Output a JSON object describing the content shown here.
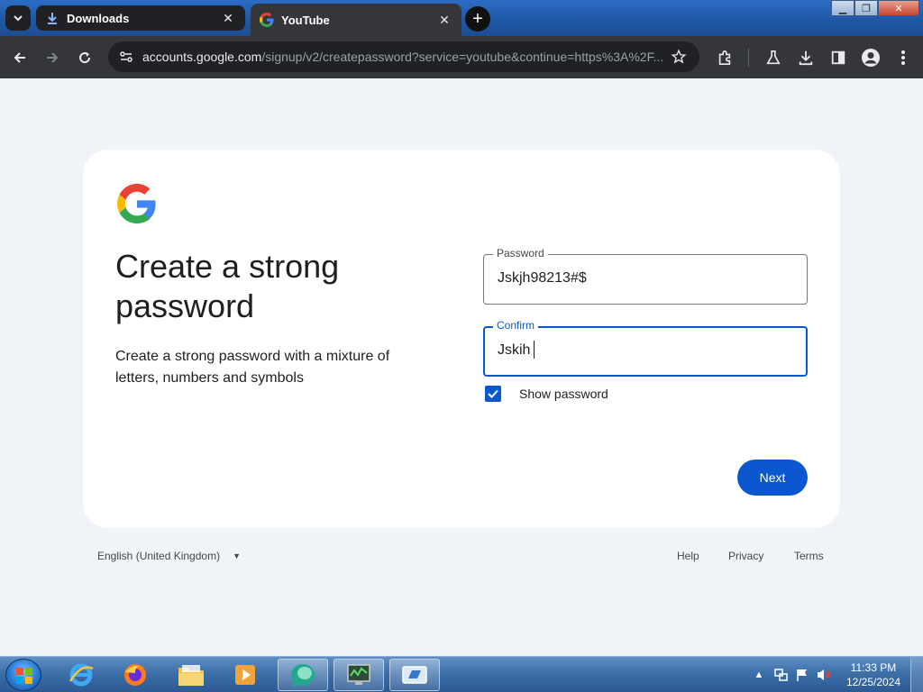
{
  "browser": {
    "tabs": [
      {
        "title": "Downloads",
        "icon": "download-icon",
        "active": false
      },
      {
        "title": "YouTube",
        "icon": "google-g-icon",
        "active": true
      }
    ],
    "url_host": "accounts.google.com",
    "url_path": "/signup/v2/createpassword?service=youtube&continue=https%3A%2F..."
  },
  "page": {
    "heading": "Create a strong password",
    "subtext": "Create a strong password with a mixture of letters, numbers and symbols",
    "password": {
      "label": "Password",
      "value": "Jskjh98213#$"
    },
    "confirm": {
      "label": "Confirm",
      "value": "Jskih"
    },
    "show_password": {
      "label": "Show password",
      "checked": true
    },
    "next_button": "Next"
  },
  "footer": {
    "language": "English (United Kingdom)",
    "links": [
      "Help",
      "Privacy",
      "Terms"
    ]
  },
  "taskbar": {
    "time": "11:33 PM",
    "date": "12/25/2024",
    "apps": [
      "internet-explorer-icon",
      "firefox-icon",
      "file-explorer-icon",
      "media-player-icon",
      "app-icon",
      "task-manager-icon",
      "remote-desktop-icon"
    ]
  },
  "colors": {
    "accent": "#0b57d0",
    "page_bg": "#f0f4f9",
    "chrome_dark": "#35363a"
  }
}
